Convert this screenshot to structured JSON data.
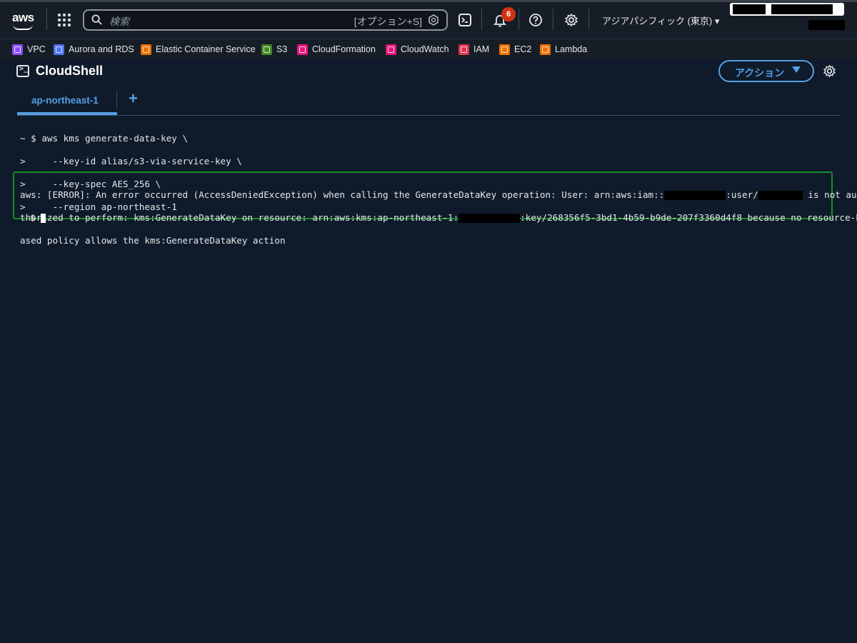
{
  "topnav": {
    "logo_text": "aws",
    "search_placeholder": "検索",
    "search_shortcut": "[オプション+S]",
    "notification_count": "6",
    "region": "アジアパシフィック (東京) ▾",
    "icons": [
      "grid-icon",
      "search-icon",
      "cloudshell-icon",
      "bell-icon",
      "help-icon",
      "gear-icon"
    ]
  },
  "bookmarks": [
    {
      "label": "VPC",
      "color": "#8c4fff"
    },
    {
      "label": "Aurora and RDS",
      "color": "#4d72f3"
    },
    {
      "label": "Elastic Container Service",
      "color": "#ed7100"
    },
    {
      "label": "S3",
      "color": "#3f8624"
    },
    {
      "label": "CloudFormation",
      "color": "#e7157b"
    },
    {
      "label": "CloudWatch",
      "color": "#e7157b"
    },
    {
      "label": "IAM",
      "color": "#dd344c"
    },
    {
      "label": "EC2",
      "color": "#ed7100"
    },
    {
      "label": "Lambda",
      "color": "#ed7100"
    }
  ],
  "header": {
    "title": "CloudShell",
    "action_label": "アクション"
  },
  "tabs": [
    {
      "label": "ap-northeast-1",
      "active": true
    }
  ],
  "terminal": {
    "command_lines": [
      "~ $ aws kms generate-data-key \\",
      ">     --key-id alias/s3-via-service-key \\",
      ">     --key-spec AES_256 \\",
      ">     --region ap-northeast-1"
    ],
    "error_line1_a": "aws: [ERROR]: An error occurred (AccessDeniedException) when calling the GenerateDataKey operation: User: arn:aws:iam::",
    "error_line1_b": ":user/",
    "error_line1_c": " is not au",
    "error_line2_a": "thorized to perform: kms:GenerateDataKey on resource: arn:aws:kms:ap-northeast-1:",
    "error_line2_b": ":key/268356f5-3bd1-4b59-b9de-207f3360d4f8 because no resource-b",
    "error_line3": "ased policy allows the kms:GenerateDataKey action",
    "prompt": "$"
  },
  "colors": {
    "accent": "#539fe5",
    "error_border": "#1d8a2e",
    "background": "#0f1b2a"
  }
}
